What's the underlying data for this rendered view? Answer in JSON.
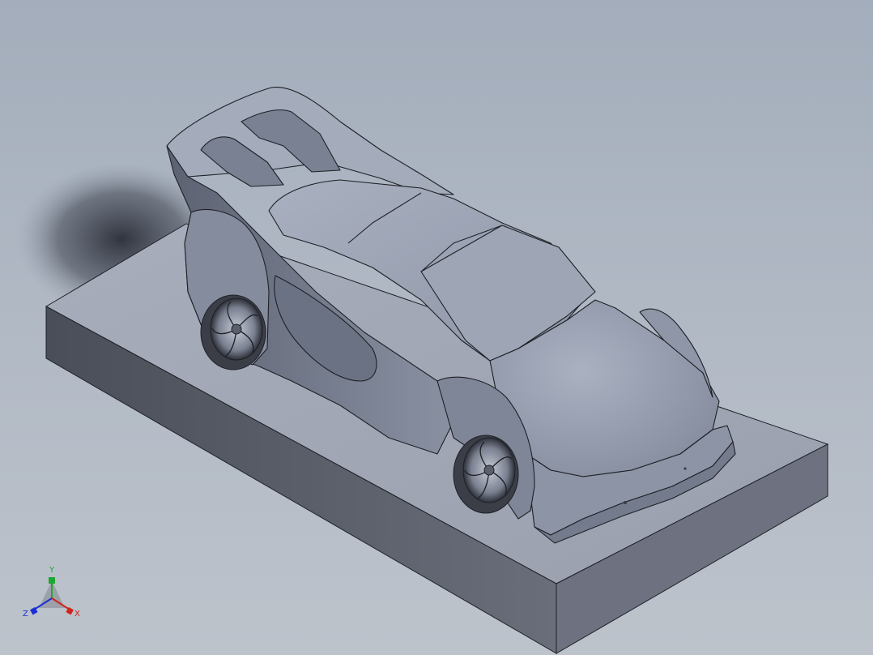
{
  "viewport": {
    "background_top": "#a3adbb",
    "background_bottom": "#bdc3cb"
  },
  "model": {
    "base_top_color": "#a9afbd",
    "base_front_color": "#5f6370",
    "base_right_color": "#70747f",
    "body_color": "#9ba2b2",
    "edge_color": "#1e2026"
  },
  "triad": {
    "y_label": "Y",
    "x_label": "X",
    "z_label": "Z",
    "y_color": "#1ca832",
    "x_color": "#d2231c",
    "z_color": "#1c2fd4"
  }
}
